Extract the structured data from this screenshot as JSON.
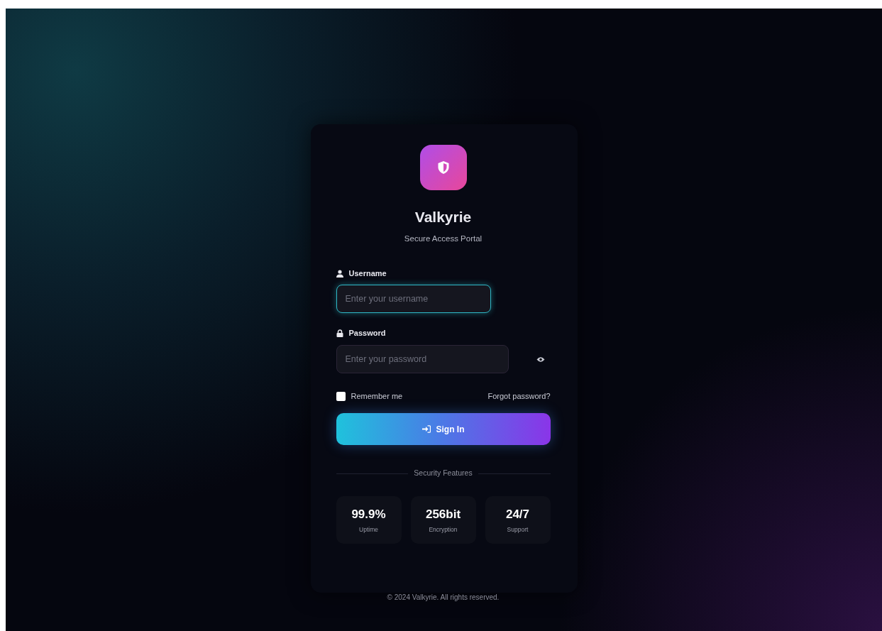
{
  "brand": {
    "title": "Valkyrie",
    "subtitle": "Secure Access Portal"
  },
  "fields": [
    {
      "kind": "text",
      "label": "Username",
      "placeholder": "Enter your username",
      "focused": true
    },
    {
      "kind": "password",
      "label": "Password",
      "placeholder": "Enter your password",
      "focused": false
    }
  ],
  "remember": {
    "label": "Remember me",
    "checked": false
  },
  "forgot_link": "Forgot password?",
  "submit": "Sign In",
  "features": {
    "title": "Security Features",
    "items": [
      {
        "value": "99.9%",
        "label": "Uptime"
      },
      {
        "value": "256bit",
        "label": "Encryption"
      },
      {
        "value": "24/7",
        "label": "Support"
      }
    ]
  },
  "footer": "© 2024 Valkyrie. All rights reserved."
}
